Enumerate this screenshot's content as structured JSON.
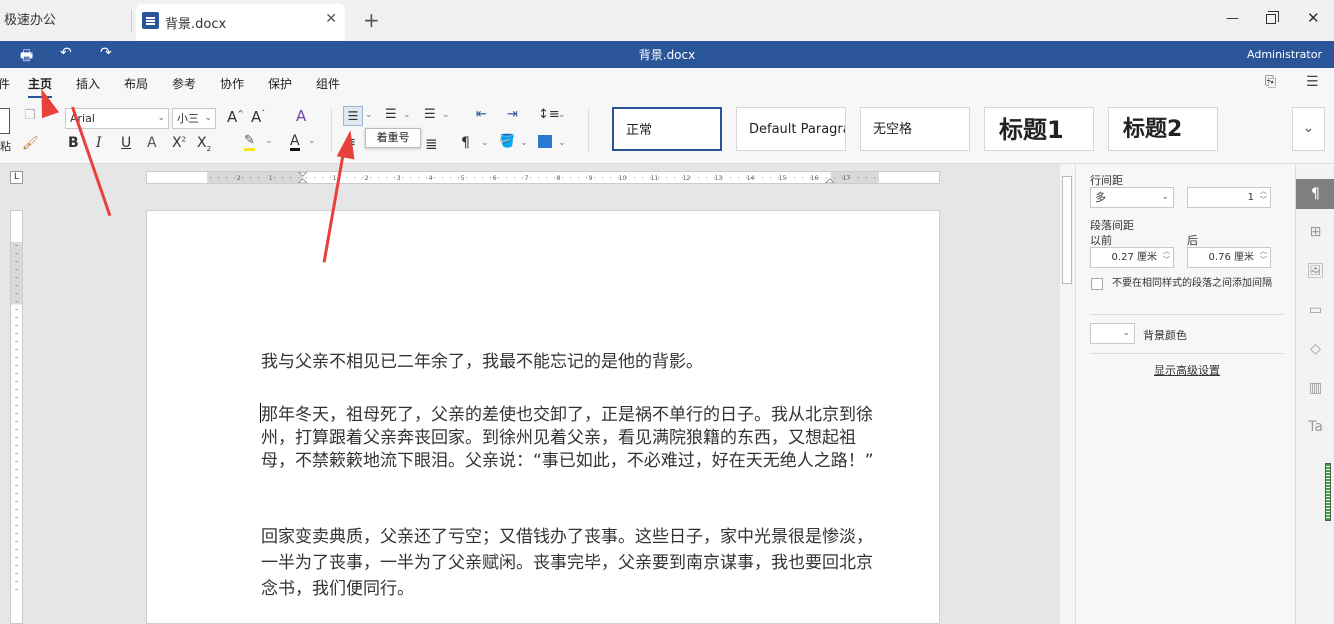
{
  "tabs": {
    "home_label": "极速办公",
    "doc_label": "背景.docx"
  },
  "titlebar": {
    "doc_title": "背景.docx",
    "user": "Administrator"
  },
  "menu": {
    "items": [
      "件",
      "主页",
      "插入",
      "布局",
      "参考",
      "协作",
      "保护",
      "组件"
    ],
    "active": "主页"
  },
  "ribbon": {
    "font_name": "Arial",
    "font_size": "小三",
    "tooltip": "着重号",
    "styles": [
      "正常",
      "Default Paragraph",
      "无空格",
      "标题1",
      "标题2"
    ],
    "paste_label": "粘"
  },
  "ruler": {
    "h_numbers": [
      "2",
      "1",
      "1",
      "2",
      "3",
      "4",
      "5",
      "6",
      "7",
      "8",
      "9",
      "10",
      "11",
      "12",
      "13",
      "14",
      "15",
      "16",
      "17"
    ]
  },
  "document": {
    "paragraphs": [
      "我与父亲不相见已二年余了，我最不能忘记的是他的背影。",
      "那年冬天，祖母死了，父亲的差使也交卸了，正是祸不单行的日子。我从北京到徐州，打算跟着父亲奔丧回家。到徐州见着父亲，看见满院狼籍的东西，又想起祖母，不禁簌簌地流下眼泪。父亲说：“事已如此，不必难过，好在天无绝人之路！”",
      "回家变卖典质，父亲还了亏空；又借钱办了丧事。这些日子，家中光景很是惨淡，一半为了丧事，一半为了父亲赋闲。丧事完毕，父亲要到南京谋事，我也要回北京念书，我们便同行。"
    ]
  },
  "panel": {
    "line_spacing_label": "行间距",
    "line_spacing_type": "多",
    "line_spacing_value": "1",
    "para_spacing_label": "段落间距",
    "before_label": "以前",
    "after_label": "后",
    "before_value": "0.27 厘米",
    "after_value": "0.76 厘米",
    "no_space_label": "不要在相同样式的段落之间添加间隔",
    "bg_color_label": "背景颜色",
    "advanced_label": "显示高级设置"
  },
  "colors": {
    "brand": "#2a5599",
    "arrow": "#e8413c"
  }
}
